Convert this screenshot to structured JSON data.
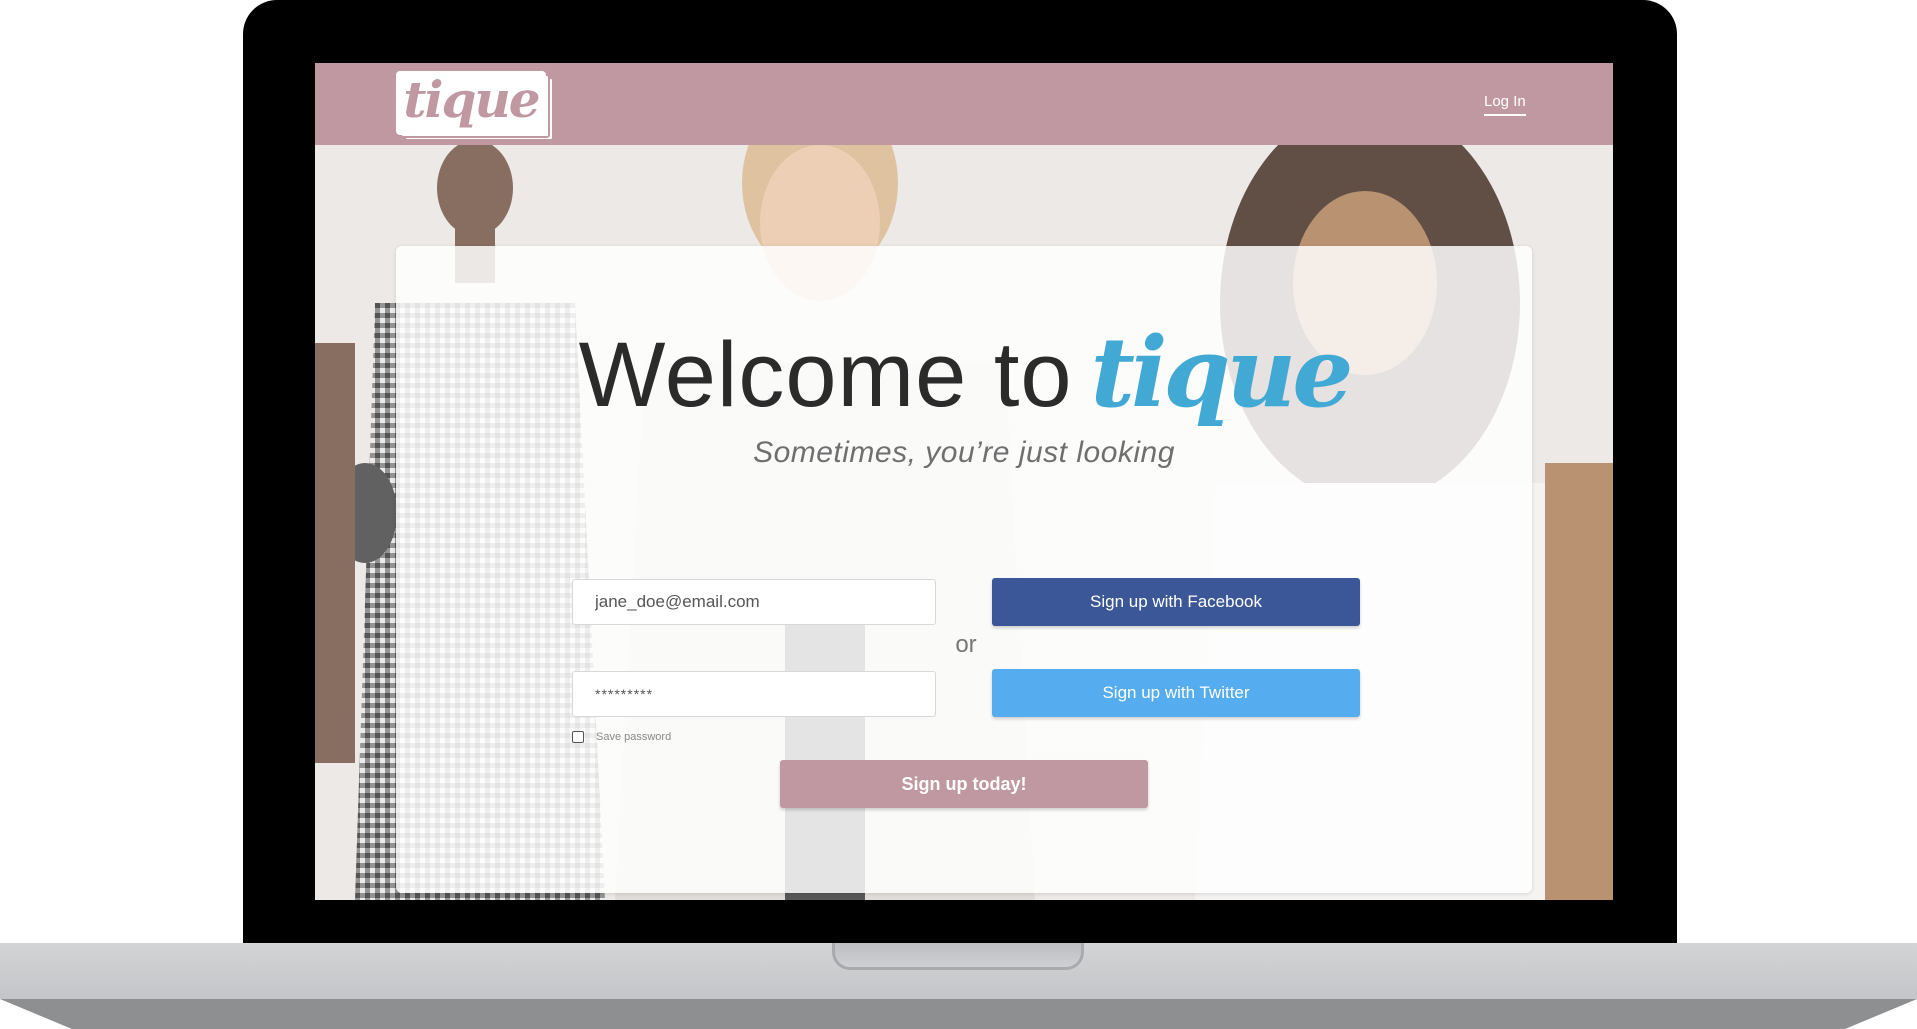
{
  "navbar": {
    "logo_text": "tique",
    "login_label": "Log In"
  },
  "hero": {
    "headline_prefix": "Welcome to",
    "headline_brand": "tique",
    "tagline": "Sometimes, you’re just looking"
  },
  "form": {
    "email_value": "jane_doe@email.com",
    "password_value": "*********",
    "save_password_label": "Save password",
    "or_label": "or",
    "facebook_label": "Sign up with Facebook",
    "twitter_label": "Sign up with Twitter",
    "signup_label": "Sign up today!"
  },
  "colors": {
    "brand_mauve": "#bf98a1",
    "brand_blue": "#41a9d3",
    "facebook": "#3b5797",
    "twitter": "#55acee"
  }
}
